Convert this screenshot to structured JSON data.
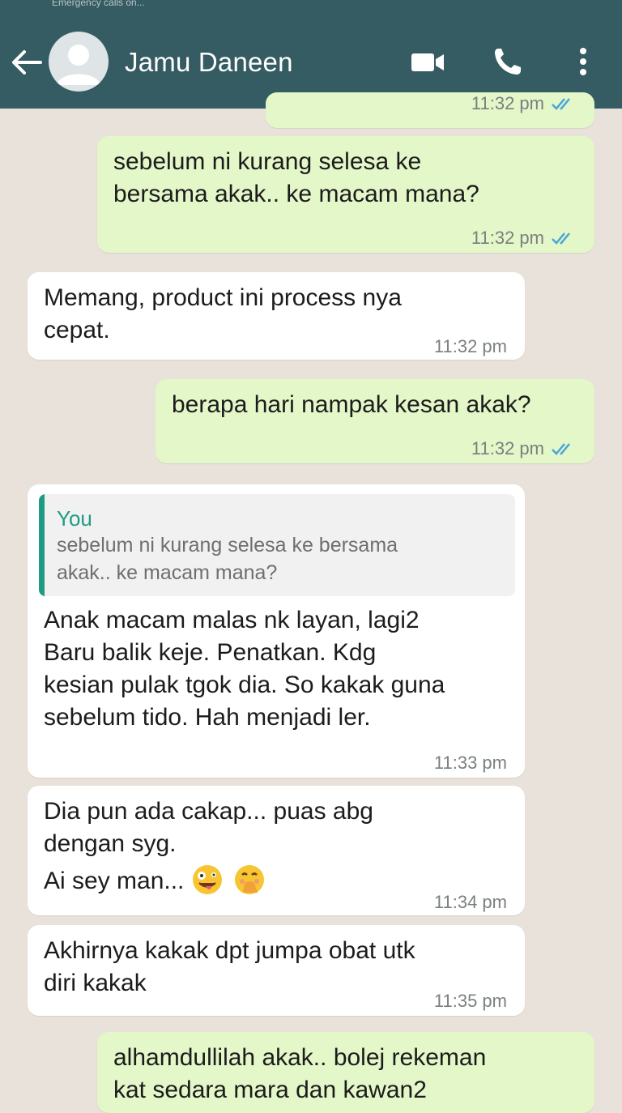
{
  "status_bar": {
    "text": "Emergency calls on..."
  },
  "header": {
    "contact_name": "Jamu Daneen"
  },
  "messages": [
    {
      "direction": "out",
      "text": "...",
      "time": "11:32 pm",
      "read": true
    },
    {
      "direction": "out",
      "text": "sebelum ni kurang selesa ke\nbersama akak.. ke macam mana?",
      "time": "11:32 pm",
      "read": true
    },
    {
      "direction": "in",
      "text": "Memang, product ini process nya\ncepat.",
      "time": "11:32 pm"
    },
    {
      "direction": "out",
      "text": "berapa hari nampak kesan akak?",
      "time": "11:32 pm",
      "read": true
    },
    {
      "direction": "in",
      "quote": {
        "author": "You",
        "text": "sebelum ni kurang selesa ke bersama\nakak.. ke macam mana?"
      },
      "text": "Anak macam malas nk layan, lagi2\nBaru balik keje. Penatkan. Kdg\nkesian pulak tgok dia. So kakak guna\nsebelum tido. Hah menjadi ler.",
      "time": "11:33 pm"
    },
    {
      "direction": "in",
      "text": "Dia pun ada cakap... puas abg\ndengan syg.",
      "text2": "Ai sey man...",
      "emojis": [
        "zany-face-emoji",
        "hand-over-mouth-emoji"
      ],
      "time": "11:34 pm"
    },
    {
      "direction": "in",
      "text": "Akhirnya kakak dpt jumpa obat utk\ndiri kakak",
      "time": "11:35 pm"
    },
    {
      "direction": "out",
      "text": "alhamdullilah akak.. bolej rekeman\nkat sedara mara dan kawan2",
      "time": "",
      "read": true
    }
  ],
  "colors": {
    "header": "#355c63",
    "outgoing": "#e3f7c9",
    "incoming": "#ffffff",
    "read_tick": "#4aa6d6",
    "quote_accent": "#1e9b84"
  },
  "icons": [
    "back-arrow-icon",
    "avatar-icon",
    "video-call-icon",
    "voice-call-icon",
    "more-vert-icon",
    "read-tick-icon"
  ]
}
